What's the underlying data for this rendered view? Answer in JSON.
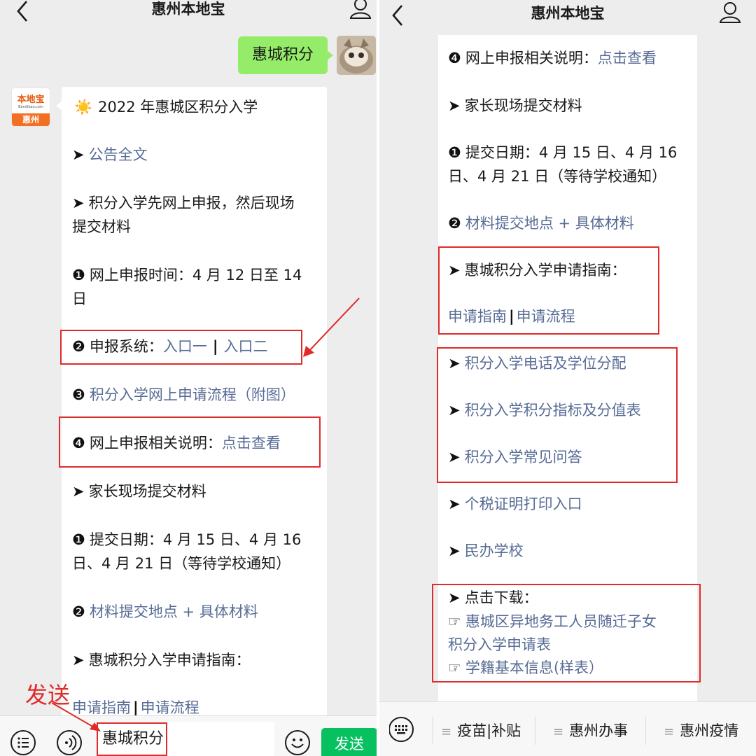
{
  "app": {
    "title": "惠州本地宝"
  },
  "colors": {
    "link": "#576b95",
    "bubble_out": "#95ec69",
    "send": "#07c160",
    "annotation": "#e02b2b",
    "brand": "#f36f21"
  },
  "left": {
    "sent_message": "惠城积分",
    "bot_logo": {
      "top": "本地宝",
      "url": "Bendibao.com",
      "city": "惠州"
    },
    "card": {
      "heading_icon": "☀️",
      "heading": "2022 年惠城区积分入学",
      "l1_link": "公告全文",
      "l2_a": "积分入学先网上申报，然后现场",
      "l2_b": "提交材料",
      "l3_a": "网上申报时间：4 月 12 日至 14",
      "l3_b": "日",
      "l4_text": "申报系统：",
      "l4_link1": "入口一",
      "l4_sep": "|",
      "l4_link2": "入口二",
      "l5_link": "积分入学网上申请流程（附图）",
      "l6_text": "网上申报相关说明：",
      "l6_link": "点击查看",
      "l7": "家长现场提交材料",
      "l8_a": "提交日期：4 月 15 日、4 月 16",
      "l8_b": "日、4 月 21 日（等待学校通知）",
      "l9_link": "材料提交地点 + 具体材料",
      "l10": "惠城积分入学申请指南：",
      "l11_link1": "申请指南",
      "l11_sep": "|",
      "l11_link2": "申请流程"
    },
    "annotation": "发送",
    "input_value": "惠城积分",
    "send_label": "发送"
  },
  "right": {
    "card": {
      "r1_text": "网上申报相关说明：",
      "r1_link": "点击查看",
      "r2": "家长现场提交材料",
      "r3_a": "提交日期：4 月 15 日、4 月 16",
      "r3_b": "日、4 月 21 日（等待学校通知）",
      "r4_link": "材料提交地点 + 具体材料",
      "r5": "惠城积分入学申请指南：",
      "r6_link1": "申请指南",
      "r6_sep": "|",
      "r6_link2": "申请流程",
      "r7_link": "积分入学电话及学位分配",
      "r8_link": "积分入学积分指标及分值表",
      "r9_link": "积分入学常见问答",
      "r10_link": "个税证明打印入口",
      "r11_link": "民办学校",
      "r12": "点击下载：",
      "r13_a": "惠城区异地务工人员随迁子女",
      "r13_b": "积分入学申请表",
      "r14_link": "学籍基本信息(样表）"
    },
    "menu": [
      "疫苗|补贴",
      "惠州办事",
      "惠州疫情"
    ]
  },
  "glyphs": {
    "arrow": "➤",
    "n1": "❶",
    "n2": "❷",
    "n3": "❸",
    "n4": "❹",
    "hand": "☞",
    "hamburger": "≡"
  }
}
